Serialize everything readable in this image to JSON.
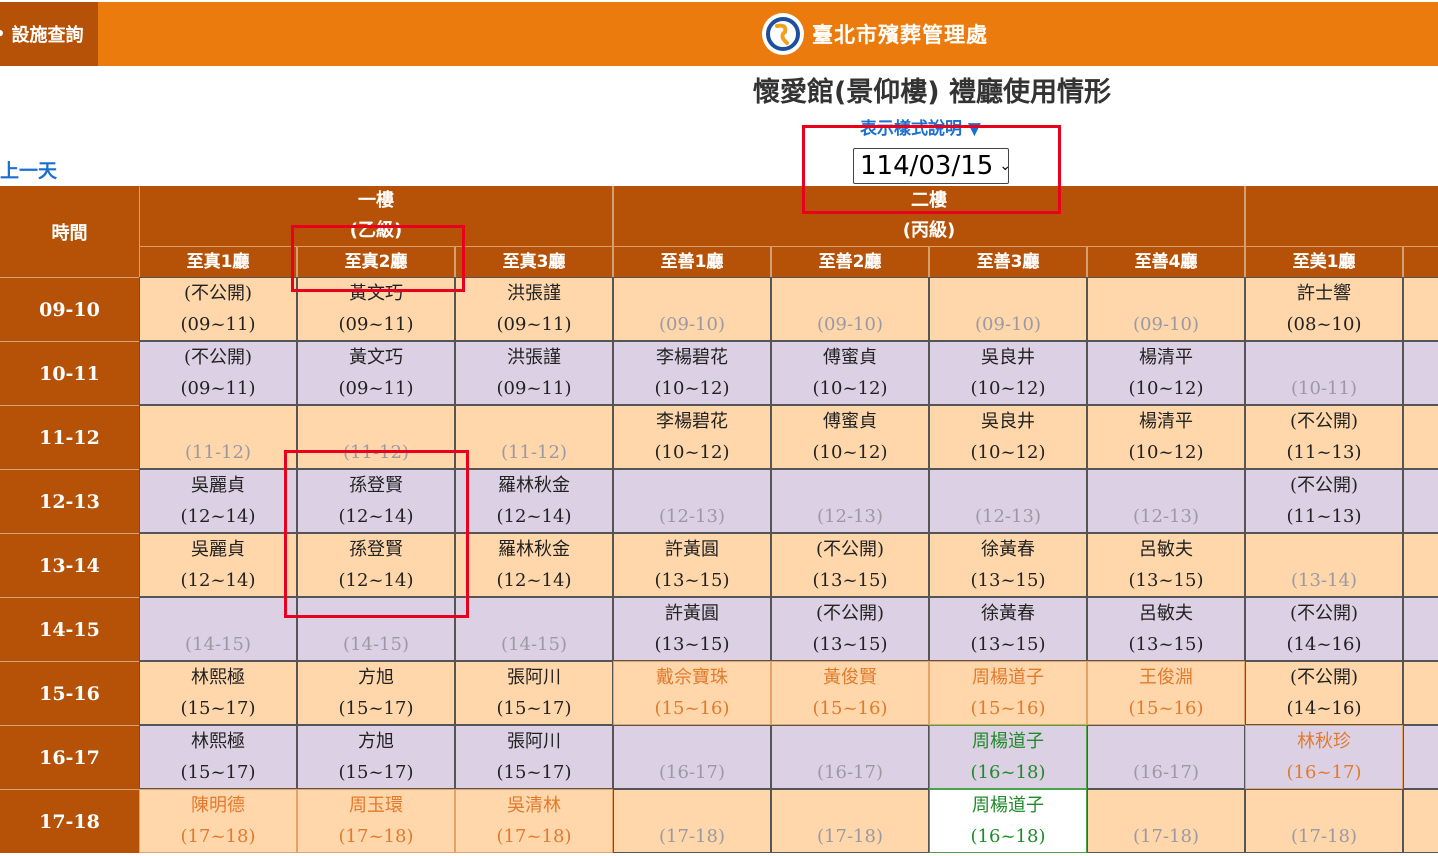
{
  "header": {
    "nav_label": "設施查詢",
    "brand": "臺北市殯葬管理處",
    "page_title": "懷愛館(景仰樓) 禮廳使用情形",
    "legend_toggle": "表示樣式說明 ▼",
    "date": "114/03/15",
    "prev_day": "上一天",
    "colors": {
      "bar": "#ea7b0c",
      "dark": "#b55208",
      "peach": "#ffd7ab",
      "lavender": "#dcd1e4",
      "highlight": "#e8001c"
    }
  },
  "table": {
    "time_header": "時間",
    "floors": [
      {
        "name": "一樓",
        "grade": "(乙級)"
      },
      {
        "name": "二樓",
        "grade": "(丙級)"
      }
    ],
    "halls": [
      "至真1廳",
      "至真2廳",
      "至真3廳",
      "至善1廳",
      "至善2廳",
      "至善3廳",
      "至善4廳",
      "至美1廳"
    ],
    "times": [
      "09-10",
      "10-11",
      "11-12",
      "12-13",
      "13-14",
      "14-15",
      "15-16",
      "16-17",
      "17-18"
    ],
    "rows": [
      [
        [
          "(不公開)",
          "(09~11)",
          "black"
        ],
        [
          "黃文巧",
          "(09~11)",
          "black"
        ],
        [
          "洪張謹",
          "(09~11)",
          "black"
        ],
        [
          "",
          "(09-10)",
          "empty"
        ],
        [
          "",
          "(09-10)",
          "empty"
        ],
        [
          "",
          "(09-10)",
          "empty"
        ],
        [
          "",
          "(09-10)",
          "empty"
        ],
        [
          "許士響",
          "(08~10)",
          "black"
        ]
      ],
      [
        [
          "(不公開)",
          "(09~11)",
          "black"
        ],
        [
          "黃文巧",
          "(09~11)",
          "black"
        ],
        [
          "洪張謹",
          "(09~11)",
          "black"
        ],
        [
          "李楊碧花",
          "(10~12)",
          "black"
        ],
        [
          "傅蜜貞",
          "(10~12)",
          "black"
        ],
        [
          "吳良井",
          "(10~12)",
          "black"
        ],
        [
          "楊清平",
          "(10~12)",
          "black"
        ],
        [
          "",
          "(10-11)",
          "empty"
        ]
      ],
      [
        [
          "",
          "(11-12)",
          "empty"
        ],
        [
          "",
          "(11-12)",
          "empty"
        ],
        [
          "",
          "(11-12)",
          "empty"
        ],
        [
          "李楊碧花",
          "(10~12)",
          "black"
        ],
        [
          "傅蜜貞",
          "(10~12)",
          "black"
        ],
        [
          "吳良井",
          "(10~12)",
          "black"
        ],
        [
          "楊清平",
          "(10~12)",
          "black"
        ],
        [
          "(不公開)",
          "(11~13)",
          "black"
        ]
      ],
      [
        [
          "吳麗貞",
          "(12~14)",
          "black"
        ],
        [
          "孫登賢",
          "(12~14)",
          "black"
        ],
        [
          "羅林秋金",
          "(12~14)",
          "black"
        ],
        [
          "",
          "(12-13)",
          "empty"
        ],
        [
          "",
          "(12-13)",
          "empty"
        ],
        [
          "",
          "(12-13)",
          "empty"
        ],
        [
          "",
          "(12-13)",
          "empty"
        ],
        [
          "(不公開)",
          "(11~13)",
          "black"
        ]
      ],
      [
        [
          "吳麗貞",
          "(12~14)",
          "black"
        ],
        [
          "孫登賢",
          "(12~14)",
          "black"
        ],
        [
          "羅林秋金",
          "(12~14)",
          "black"
        ],
        [
          "許黃圓",
          "(13~15)",
          "black"
        ],
        [
          "(不公開)",
          "(13~15)",
          "black"
        ],
        [
          "徐黃春",
          "(13~15)",
          "black"
        ],
        [
          "呂敏夫",
          "(13~15)",
          "black"
        ],
        [
          "",
          "(13-14)",
          "empty"
        ]
      ],
      [
        [
          "",
          "(14-15)",
          "empty"
        ],
        [
          "",
          "(14-15)",
          "empty"
        ],
        [
          "",
          "(14-15)",
          "empty"
        ],
        [
          "許黃圓",
          "(13~15)",
          "black"
        ],
        [
          "(不公開)",
          "(13~15)",
          "black"
        ],
        [
          "徐黃春",
          "(13~15)",
          "black"
        ],
        [
          "呂敏夫",
          "(13~15)",
          "black"
        ],
        [
          "(不公開)",
          "(14~16)",
          "black"
        ]
      ],
      [
        [
          "林熙極",
          "(15~17)",
          "black"
        ],
        [
          "方旭",
          "(15~17)",
          "black"
        ],
        [
          "張阿川",
          "(15~17)",
          "black"
        ],
        [
          "戴佘寶珠",
          "(15~16)",
          "orange"
        ],
        [
          "黃俊賢",
          "(15~16)",
          "orange"
        ],
        [
          "周楊道子",
          "(15~16)",
          "orange"
        ],
        [
          "王俊淵",
          "(15~16)",
          "orange"
        ],
        [
          "(不公開)",
          "(14~16)",
          "black"
        ]
      ],
      [
        [
          "林熙極",
          "(15~17)",
          "black"
        ],
        [
          "方旭",
          "(15~17)",
          "black"
        ],
        [
          "張阿川",
          "(15~17)",
          "black"
        ],
        [
          "",
          "(16-17)",
          "empty"
        ],
        [
          "",
          "(16-17)",
          "empty"
        ],
        [
          "周楊道子",
          "(16~18)",
          "green"
        ],
        [
          "",
          "(16-17)",
          "empty"
        ],
        [
          "林秋珍",
          "(16~17)",
          "orange"
        ]
      ],
      [
        [
          "陳明德",
          "(17~18)",
          "orange"
        ],
        [
          "周玉環",
          "(17~18)",
          "orange"
        ],
        [
          "吳清林",
          "(17~18)",
          "orange"
        ],
        [
          "",
          "(17-18)",
          "empty"
        ],
        [
          "",
          "(17-18)",
          "empty"
        ],
        [
          "周楊道子",
          "(16~18)",
          "green"
        ],
        [
          "",
          "(17-18)",
          "empty"
        ],
        [
          "",
          "(17-18)",
          "empty"
        ]
      ]
    ]
  }
}
